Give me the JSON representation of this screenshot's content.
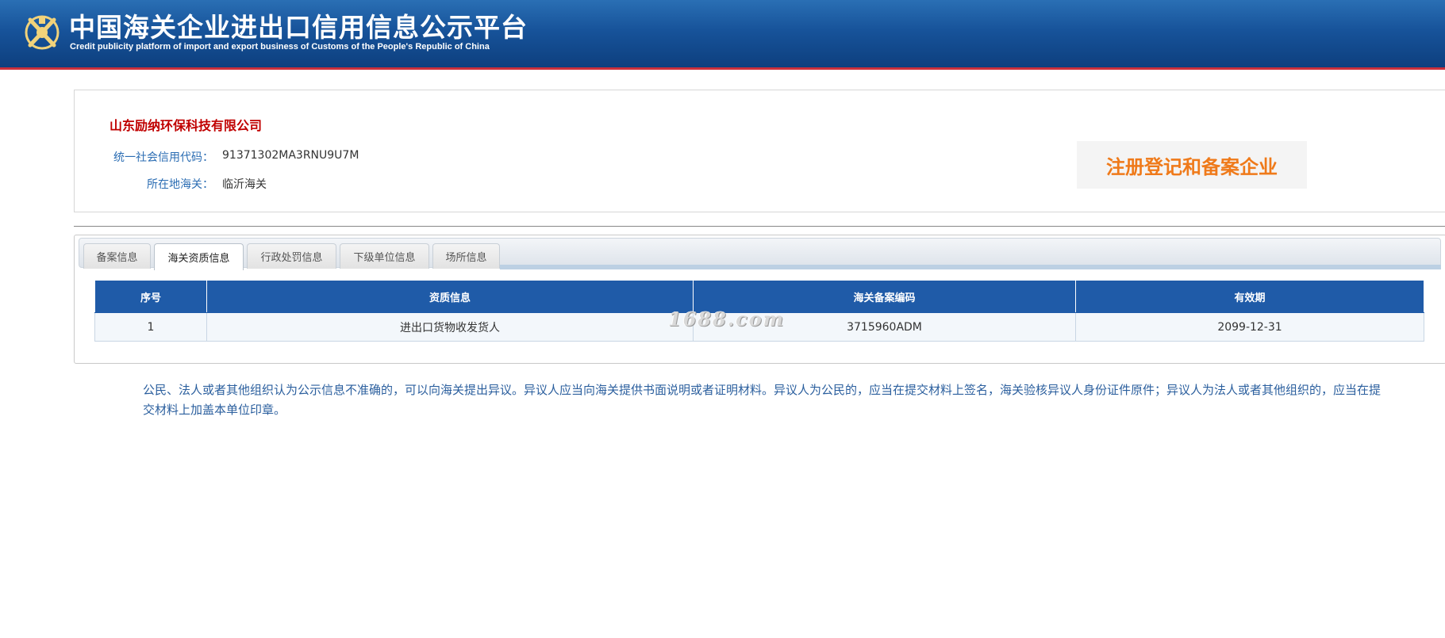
{
  "header": {
    "title": "中国海关企业进出口信用信息公示平台",
    "subtitle": "Credit publicity platform of import and export business of Customs of the People's Republic of China",
    "logo_icon": "customs-emblem-icon"
  },
  "company": {
    "name": "山东励纳环保科技有限公司",
    "credit_code_label": "统一社会信用代码：",
    "credit_code": "91371302MA3RNU9U7M",
    "customs_label": "所在地海关：",
    "customs": "临沂海关",
    "badge": "注册登记和备案企业"
  },
  "tabs": [
    {
      "label": "备案信息",
      "active": false
    },
    {
      "label": "海关资质信息",
      "active": true
    },
    {
      "label": "行政处罚信息",
      "active": false
    },
    {
      "label": "下级单位信息",
      "active": false
    },
    {
      "label": "场所信息",
      "active": false
    }
  ],
  "table": {
    "columns": [
      "序号",
      "资质信息",
      "海关备案编码",
      "有效期"
    ],
    "rows": [
      [
        "1",
        "进出口货物收发货人",
        "3715960ADM",
        "2099-12-31"
      ]
    ]
  },
  "watermark": "1688.com",
  "notice": "公民、法人或者其他组织认为公示信息不准确的，可以向海关提出异议。异议人应当向海关提供书面说明或者证明材料。异议人为公民的，应当在提交材料上签名，海关验核异议人身份证件原件；异议人为法人或者其他组织的，应当在提交材料上加盖本单位印章。",
  "colors": {
    "header_blue": "#17539a",
    "accent_red": "#c9303c",
    "company_name": "#c00000",
    "label_blue": "#2b6db3",
    "badge_orange": "#ef7a1a",
    "table_header": "#1f5ba8"
  }
}
